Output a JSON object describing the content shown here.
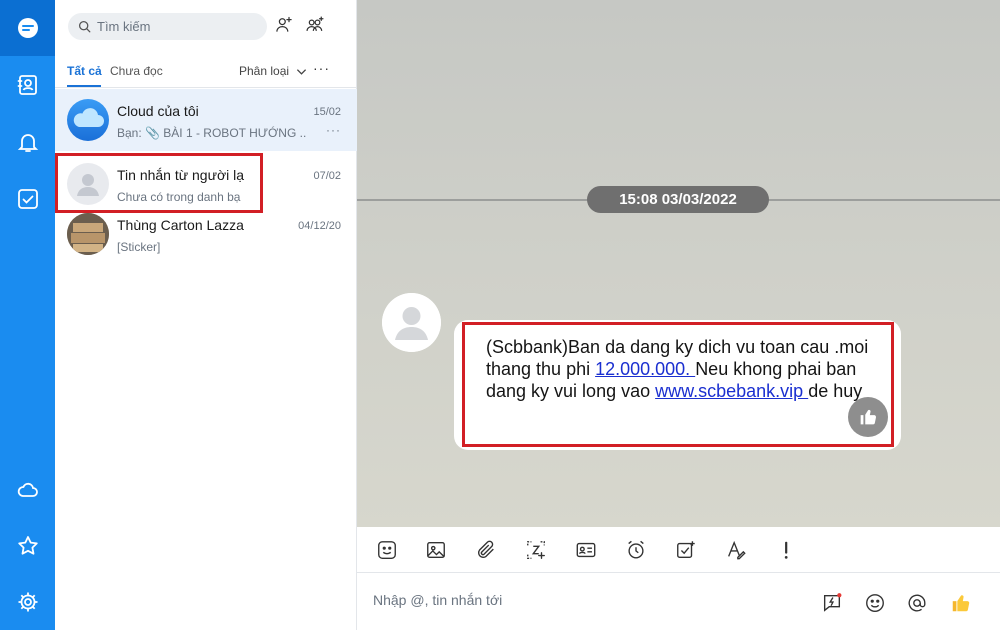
{
  "search": {
    "placeholder": "Tìm kiếm"
  },
  "tabs": {
    "all": "Tất cả",
    "unread": "Chưa đọc",
    "filter": "Phân loại",
    "more": "···"
  },
  "conversations": [
    {
      "name": "Cloud của tôi",
      "subtitle": "Bạn: 📎 BÀI 1 - ROBOT HƯỚNG ...",
      "time": "15/02",
      "more": "···"
    },
    {
      "name": "Tin nhắn từ người lạ",
      "subtitle": "Chưa có trong danh bạ",
      "time": "07/02"
    },
    {
      "name": "Thùng Carton Lazza",
      "subtitle": "[Sticker]",
      "time": "04/12/20"
    }
  ],
  "chat": {
    "date_separator": "15:08 03/03/2022",
    "message": {
      "text_before_amount": "(Scbbank)Ban da dang ky dich vu toan cau .moi thang thu phi ",
      "amount_link": "12.000.000. ",
      "text_middle": "Neu khong phai ban dang ky vui long vao ",
      "url_link": "www.scbebank.vip ",
      "text_after": "de huy"
    }
  },
  "composer": {
    "placeholder": "Nhập @, tin nhắn tới"
  },
  "colors": {
    "rail": "#1a8cf0",
    "highlight": "#d21f25",
    "link": "#1a2fd0",
    "accent": "#1a72d6"
  }
}
